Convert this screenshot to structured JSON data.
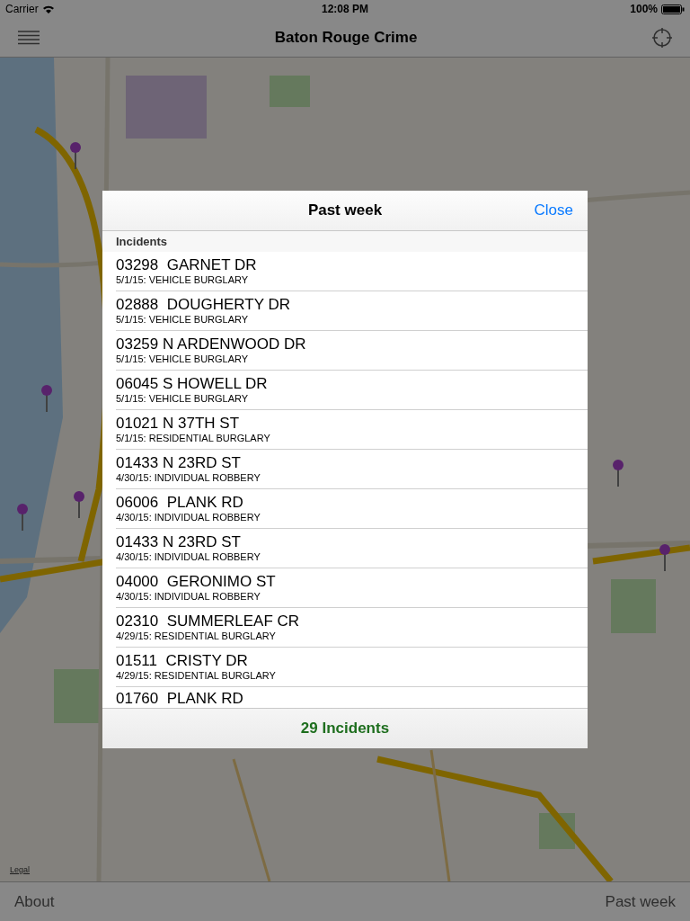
{
  "status_bar": {
    "carrier": "Carrier",
    "time": "12:08 PM",
    "battery": "100%"
  },
  "nav_bar": {
    "title": "Baton Rouge Crime"
  },
  "map": {
    "kind": "picture",
    "legal_link": "Legal"
  },
  "popover": {
    "title": "Past week",
    "close": "Close",
    "section": "Incidents",
    "incidents": [
      {
        "address": "03298  GARNET DR",
        "detail": "5/1/15: VEHICLE BURGLARY"
      },
      {
        "address": "02888  DOUGHERTY DR",
        "detail": "5/1/15: VEHICLE BURGLARY"
      },
      {
        "address": "03259 N ARDENWOOD DR",
        "detail": "5/1/15: VEHICLE BURGLARY"
      },
      {
        "address": "06045 S HOWELL DR",
        "detail": "5/1/15: VEHICLE BURGLARY"
      },
      {
        "address": "01021 N 37TH ST",
        "detail": "5/1/15: RESIDENTIAL BURGLARY"
      },
      {
        "address": "01433 N 23RD ST",
        "detail": "4/30/15: INDIVIDUAL ROBBERY"
      },
      {
        "address": "06006  PLANK RD",
        "detail": "4/30/15: INDIVIDUAL ROBBERY"
      },
      {
        "address": "01433 N 23RD ST",
        "detail": "4/30/15: INDIVIDUAL ROBBERY"
      },
      {
        "address": "04000  GERONIMO ST",
        "detail": "4/30/15: INDIVIDUAL ROBBERY"
      },
      {
        "address": "02310  SUMMERLEAF CR",
        "detail": "4/29/15: RESIDENTIAL BURGLARY"
      },
      {
        "address": "01511  CRISTY DR",
        "detail": "4/29/15: RESIDENTIAL BURGLARY"
      },
      {
        "address": "01760  PLANK RD"
      }
    ],
    "footer": "29 Incidents"
  },
  "toolbar": {
    "left": "About",
    "right": "Past week"
  }
}
